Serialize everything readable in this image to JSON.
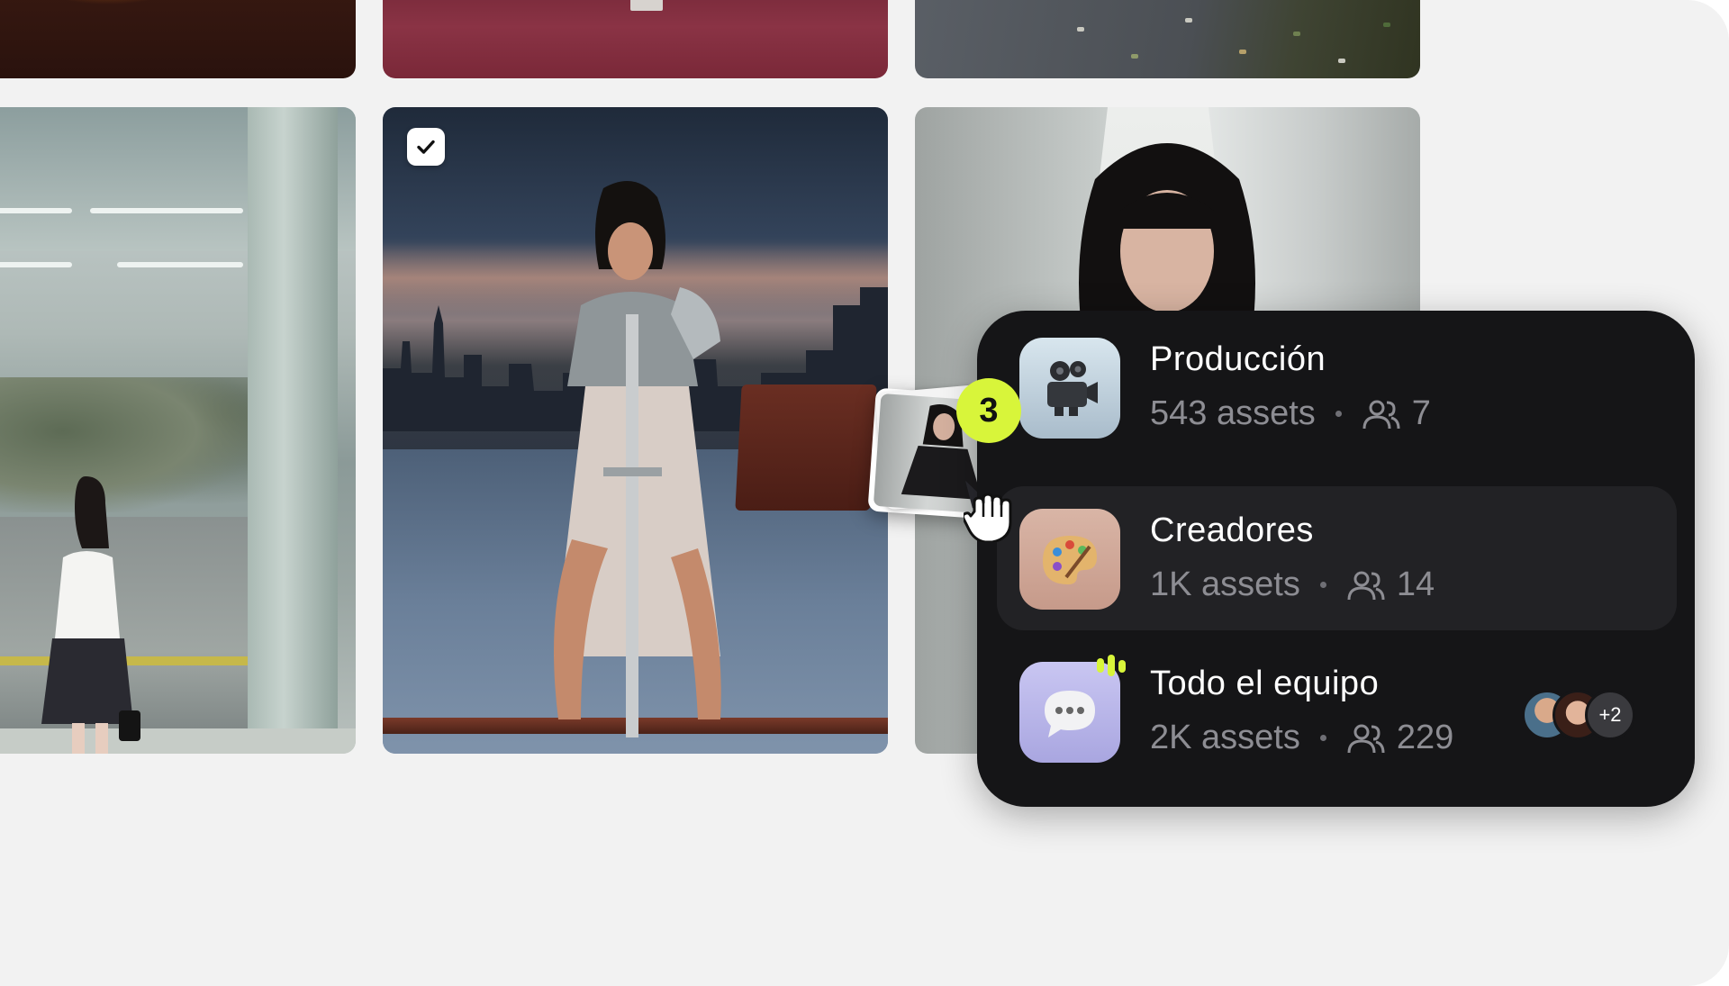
{
  "gallery": {
    "selected_tile_checked": true
  },
  "drag": {
    "count": "3"
  },
  "workspaces": [
    {
      "title": "Producción",
      "assets": "543 assets",
      "members": "7",
      "icon": "film-camera-icon"
    },
    {
      "title": "Creadores",
      "assets": "1K assets",
      "members": "14",
      "icon": "paint-palette-icon"
    },
    {
      "title": "Todo el equipo",
      "assets": "2K assets",
      "members": "229",
      "icon": "speech-bubble-icon",
      "extra_members": "+2"
    }
  ],
  "colors": {
    "panel": "#151517",
    "badge": "#d8f53a",
    "canvas": "#f2f2f2"
  }
}
